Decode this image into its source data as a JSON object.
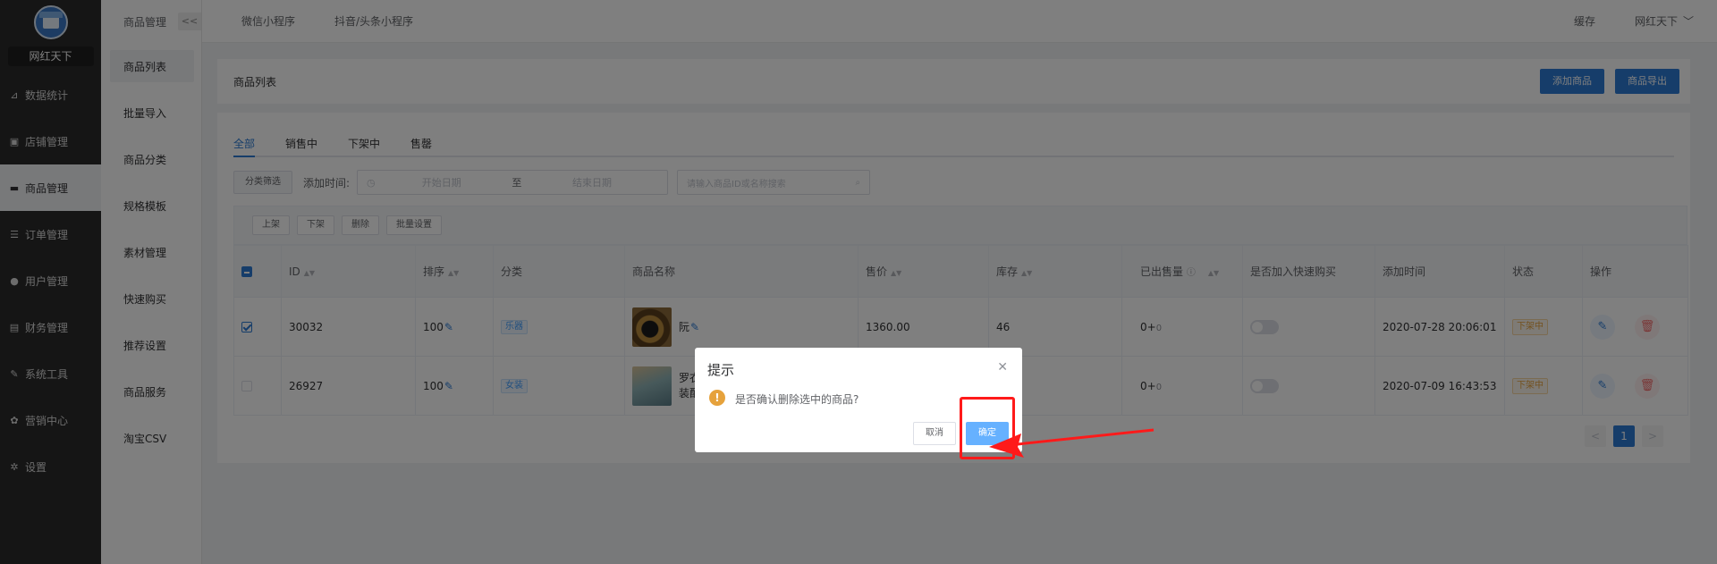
{
  "sidebar": {
    "store_name": "网红天下",
    "items": [
      {
        "label": "数据统计",
        "icon": "chart-line-icon",
        "glyph": "⊿"
      },
      {
        "label": "店铺管理",
        "icon": "store-icon",
        "glyph": "▣"
      },
      {
        "label": "商品管理",
        "icon": "goods-icon",
        "glyph": "▬"
      },
      {
        "label": "订单管理",
        "icon": "order-icon",
        "glyph": "☰"
      },
      {
        "label": "用户管理",
        "icon": "user-icon",
        "glyph": "●"
      },
      {
        "label": "财务管理",
        "icon": "finance-icon",
        "glyph": "▤"
      },
      {
        "label": "系统工具",
        "icon": "wrench-icon",
        "glyph": "✎"
      },
      {
        "label": "营销中心",
        "icon": "marketing-icon",
        "glyph": "✿"
      },
      {
        "label": "设置",
        "icon": "settings-icon",
        "glyph": "✲"
      }
    ]
  },
  "subbar": {
    "title": "商品管理",
    "collapse_label": "<<",
    "items": [
      "商品列表",
      "批量导入",
      "商品分类",
      "规格模板",
      "素材管理",
      "快速购买",
      "推荐设置",
      "商品服务",
      "淘宝CSV"
    ]
  },
  "topbar": {
    "tabs": [
      "微信小程序",
      "抖音/头条小程序"
    ],
    "cache_label": "缓存",
    "user_label": "网红天下",
    "user_caret": "﹀"
  },
  "page": {
    "title": "商品列表",
    "add_button": "添加商品",
    "export_button": "商品导出"
  },
  "tabs": [
    "全部",
    "销售中",
    "下架中",
    "售罄"
  ],
  "filters": {
    "category_button": "分类筛选",
    "date_label": "添加时间:",
    "start_placeholder": "开始日期",
    "range_sep": "至",
    "end_placeholder": "结束日期",
    "search_placeholder": "请输入商品ID或名称搜索"
  },
  "bulk_ops": [
    "上架",
    "下架",
    "删除",
    "批量设置"
  ],
  "table": {
    "columns": [
      "ID",
      "排序",
      "分类",
      "商品名称",
      "售价",
      "库存",
      "已出售量",
      "是否加入快速购买",
      "添加时间",
      "状态",
      "操作"
    ],
    "rows": [
      {
        "id": "30032",
        "sort": "100",
        "category": "乐器",
        "name": "阮",
        "price": "1360.00",
        "stock": "46",
        "sold": "0+",
        "sold_sub": "0",
        "quick_buy": false,
        "added": "2020-07-28 20:06:01",
        "status": "下架中",
        "checked": true
      },
      {
        "id": "26927",
        "sort": "100",
        "category": "女装",
        "name": "罗衣\n装配",
        "price": "",
        "stock": "",
        "sold": "0+",
        "sold_sub": "0",
        "quick_buy": false,
        "added": "2020-07-09 16:43:53",
        "status": "下架中",
        "checked": false
      }
    ]
  },
  "pagination": {
    "prev": "<",
    "current": "1",
    "next": ">"
  },
  "dialog": {
    "title": "提示",
    "message": "是否确认删除选中的商品?",
    "cancel": "取消",
    "confirm": "确定",
    "warning_glyph": "!",
    "close_glyph": "✕"
  },
  "colors": {
    "primary": "#2d7bd4",
    "annotation": "#ff1a1a"
  }
}
